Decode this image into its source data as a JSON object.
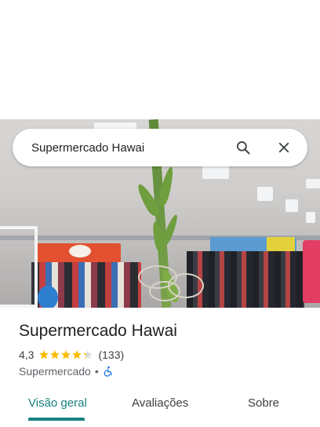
{
  "search": {
    "query": "Supermercado Hawai",
    "search_icon": "search-icon",
    "close_icon": "close-icon"
  },
  "place": {
    "name": "Supermercado Hawai",
    "rating": "4,3",
    "rating_value": 4.3,
    "stars_max": 5,
    "review_count": "(133)",
    "category": "Supermercado",
    "separator": "•",
    "accessibility_icon": "wheelchair-icon"
  },
  "tabs": [
    {
      "label": "Visão geral",
      "selected": true
    },
    {
      "label": "Avaliações",
      "selected": false
    },
    {
      "label": "Sobre",
      "selected": false
    }
  ],
  "colors": {
    "accent": "#188080",
    "star": "#fbbc04",
    "star_empty": "#dadce0",
    "wheelchair": "#1a73e8"
  }
}
